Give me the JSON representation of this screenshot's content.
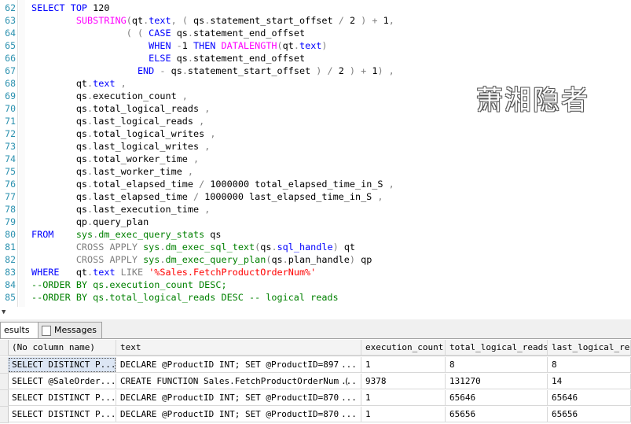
{
  "editor": {
    "lines": [
      {
        "n": "62",
        "parts": [
          [
            "kw",
            "SELECT TOP "
          ],
          [
            "",
            "120"
          ]
        ]
      },
      {
        "n": "63",
        "parts": [
          [
            "",
            "        "
          ],
          [
            "fn",
            "SUBSTRING"
          ],
          [
            "gry",
            "("
          ],
          [
            "",
            "qt"
          ],
          [
            "gry",
            "."
          ],
          [
            "kw",
            "text"
          ],
          [
            "gry",
            ", ( "
          ],
          [
            "",
            "qs"
          ],
          [
            "gry",
            "."
          ],
          [
            "",
            "statement_start_offset "
          ],
          [
            "gry",
            "/ "
          ],
          [
            "",
            "2 "
          ],
          [
            "gry",
            ") + "
          ],
          [
            "",
            "1"
          ],
          [
            "gry",
            ","
          ]
        ]
      },
      {
        "n": "64",
        "parts": [
          [
            "",
            "                 "
          ],
          [
            "gry",
            "( ( "
          ],
          [
            "kw",
            "CASE "
          ],
          [
            "",
            "qs"
          ],
          [
            "gry",
            "."
          ],
          [
            "",
            "statement_end_offset"
          ]
        ]
      },
      {
        "n": "65",
        "parts": [
          [
            "",
            "                     "
          ],
          [
            "kw",
            "WHEN "
          ],
          [
            "gry",
            "-"
          ],
          [
            "",
            "1 "
          ],
          [
            "kw",
            "THEN "
          ],
          [
            "fn",
            "DATALENGTH"
          ],
          [
            "gry",
            "("
          ],
          [
            "",
            "qt"
          ],
          [
            "gry",
            "."
          ],
          [
            "kw",
            "text"
          ],
          [
            "gry",
            ")"
          ]
        ]
      },
      {
        "n": "66",
        "parts": [
          [
            "",
            "                     "
          ],
          [
            "kw",
            "ELSE "
          ],
          [
            "",
            "qs"
          ],
          [
            "gry",
            "."
          ],
          [
            "",
            "statement_end_offset"
          ]
        ]
      },
      {
        "n": "67",
        "parts": [
          [
            "",
            "                   "
          ],
          [
            "kw",
            "END "
          ],
          [
            "gry",
            "- "
          ],
          [
            "",
            "qs"
          ],
          [
            "gry",
            "."
          ],
          [
            "",
            "statement_start_offset "
          ],
          [
            "gry",
            ") / "
          ],
          [
            "",
            "2 "
          ],
          [
            "gry",
            ") + "
          ],
          [
            "",
            "1"
          ],
          [
            "gry",
            ") ,"
          ]
        ]
      },
      {
        "n": "68",
        "parts": [
          [
            "",
            "        "
          ],
          [
            "",
            "qt"
          ],
          [
            "gry",
            "."
          ],
          [
            "kw",
            "text "
          ],
          [
            "gry",
            ","
          ]
        ]
      },
      {
        "n": "69",
        "parts": [
          [
            "",
            "        "
          ],
          [
            "",
            "qs"
          ],
          [
            "gry",
            "."
          ],
          [
            "",
            "execution_count "
          ],
          [
            "gry",
            ","
          ]
        ]
      },
      {
        "n": "70",
        "parts": [
          [
            "",
            "        "
          ],
          [
            "",
            "qs"
          ],
          [
            "gry",
            "."
          ],
          [
            "",
            "total_logical_reads "
          ],
          [
            "gry",
            ","
          ]
        ]
      },
      {
        "n": "71",
        "parts": [
          [
            "",
            "        "
          ],
          [
            "",
            "qs"
          ],
          [
            "gry",
            "."
          ],
          [
            "",
            "last_logical_reads "
          ],
          [
            "gry",
            ","
          ]
        ]
      },
      {
        "n": "72",
        "parts": [
          [
            "",
            "        "
          ],
          [
            "",
            "qs"
          ],
          [
            "gry",
            "."
          ],
          [
            "",
            "total_logical_writes "
          ],
          [
            "gry",
            ","
          ]
        ]
      },
      {
        "n": "73",
        "parts": [
          [
            "",
            "        "
          ],
          [
            "",
            "qs"
          ],
          [
            "gry",
            "."
          ],
          [
            "",
            "last_logical_writes "
          ],
          [
            "gry",
            ","
          ]
        ]
      },
      {
        "n": "74",
        "parts": [
          [
            "",
            "        "
          ],
          [
            "",
            "qs"
          ],
          [
            "gry",
            "."
          ],
          [
            "",
            "total_worker_time "
          ],
          [
            "gry",
            ","
          ]
        ]
      },
      {
        "n": "75",
        "parts": [
          [
            "",
            "        "
          ],
          [
            "",
            "qs"
          ],
          [
            "gry",
            "."
          ],
          [
            "",
            "last_worker_time "
          ],
          [
            "gry",
            ","
          ]
        ]
      },
      {
        "n": "76",
        "parts": [
          [
            "",
            "        "
          ],
          [
            "",
            "qs"
          ],
          [
            "gry",
            "."
          ],
          [
            "",
            "total_elapsed_time "
          ],
          [
            "gry",
            "/ "
          ],
          [
            "",
            "1000000 total_elapsed_time_in_S "
          ],
          [
            "gry",
            ","
          ]
        ]
      },
      {
        "n": "77",
        "parts": [
          [
            "",
            "        "
          ],
          [
            "",
            "qs"
          ],
          [
            "gry",
            "."
          ],
          [
            "",
            "last_elapsed_time "
          ],
          [
            "gry",
            "/ "
          ],
          [
            "",
            "1000000 last_elapsed_time_in_S "
          ],
          [
            "gry",
            ","
          ]
        ]
      },
      {
        "n": "78",
        "parts": [
          [
            "",
            "        "
          ],
          [
            "",
            "qs"
          ],
          [
            "gry",
            "."
          ],
          [
            "",
            "last_execution_time "
          ],
          [
            "gry",
            ","
          ]
        ]
      },
      {
        "n": "79",
        "parts": [
          [
            "",
            "        "
          ],
          [
            "",
            "qp"
          ],
          [
            "gry",
            "."
          ],
          [
            "",
            "query_plan"
          ]
        ]
      },
      {
        "n": "80",
        "parts": [
          [
            "kw",
            "FROM    "
          ],
          [
            "sys",
            "sys"
          ],
          [
            "gry",
            "."
          ],
          [
            "sys",
            "dm_exec_query_stats "
          ],
          [
            "",
            "qs"
          ]
        ]
      },
      {
        "n": "81",
        "parts": [
          [
            "",
            "        "
          ],
          [
            "gry",
            "CROSS APPLY "
          ],
          [
            "sys",
            "sys"
          ],
          [
            "gry",
            "."
          ],
          [
            "sys",
            "dm_exec_sql_text"
          ],
          [
            "gry",
            "("
          ],
          [
            "",
            "qs"
          ],
          [
            "gry",
            "."
          ],
          [
            "kw",
            "sql_handle"
          ],
          [
            "gry",
            ") "
          ],
          [
            "",
            "qt"
          ]
        ]
      },
      {
        "n": "82",
        "parts": [
          [
            "",
            "        "
          ],
          [
            "gry",
            "CROSS APPLY "
          ],
          [
            "sys",
            "sys"
          ],
          [
            "gry",
            "."
          ],
          [
            "sys",
            "dm_exec_query_plan"
          ],
          [
            "gry",
            "("
          ],
          [
            "",
            "qs"
          ],
          [
            "gry",
            "."
          ],
          [
            "",
            "plan_handle"
          ],
          [
            "gry",
            ") "
          ],
          [
            "",
            "qp"
          ]
        ]
      },
      {
        "n": "83",
        "parts": [
          [
            "kw",
            "WHERE   "
          ],
          [
            "",
            "qt"
          ],
          [
            "gry",
            "."
          ],
          [
            "kw",
            "text "
          ],
          [
            "gry",
            "LIKE "
          ],
          [
            "str",
            "'%Sales.FetchProductOrderNum%'"
          ]
        ]
      },
      {
        "n": "84",
        "parts": [
          [
            "cmt",
            "--ORDER BY qs.execution_count DESC;"
          ]
        ]
      },
      {
        "n": "85",
        "parts": [
          [
            "cmt",
            "--ORDER BY qs.total_logical_reads DESC -- logical reads"
          ]
        ]
      }
    ]
  },
  "watermark": "萧湘隐者",
  "tabs": {
    "results": "esults",
    "messages": "Messages"
  },
  "grid": {
    "columns": [
      "(No column name)",
      "text",
      "execution_count",
      "total_logical_reads",
      "last_logical_rea"
    ],
    "rows": [
      [
        "SELECT DISTINCT P...",
        "DECLARE @ProductID INT;  SET @ProductID=897",
        "1",
        "8",
        "8"
      ],
      [
        "SELECT @SaleOrder...",
        "CREATE FUNCTION Sales.FetchProductOrderNum  (",
        "9378",
        "131270",
        "14"
      ],
      [
        "SELECT DISTINCT P...",
        "DECLARE @ProductID INT;  SET @ProductID=870",
        "1",
        "65646",
        "65646"
      ],
      [
        "SELECT DISTINCT P...",
        "DECLARE @ProductID INT;  SET @ProductID=870",
        "1",
        "65656",
        "65656"
      ]
    ],
    "ellipsis": "..."
  },
  "colors": {
    "keyword": "#0000ff",
    "function": "#ff00ff",
    "system": "#008000",
    "string": "#ff0000",
    "operator": "#808080",
    "line_number": "#2b91af"
  }
}
